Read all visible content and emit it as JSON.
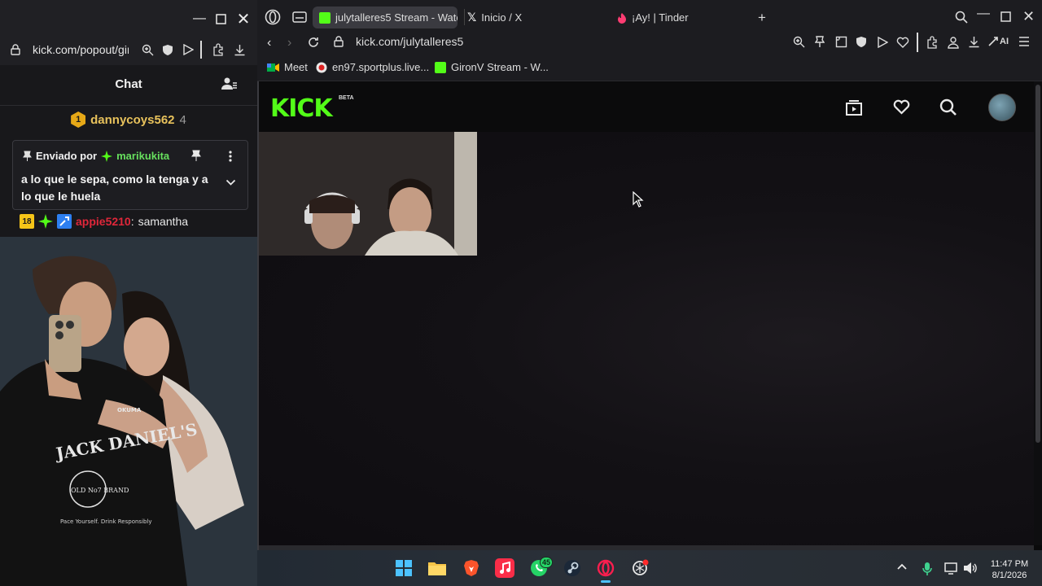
{
  "popout": {
    "url": "kick.com/popout/gir",
    "chat_title": "Chat",
    "leaderboard": {
      "rank": "1",
      "user": "dannycoys562",
      "count": "4"
    },
    "pinned": {
      "label": "Enviado por",
      "user": "marikukita",
      "message": "a lo que le sepa, como la tenga y a lo que le huela"
    },
    "chat_line": {
      "age_badge": "18",
      "user": "appie5210",
      "separator": ":",
      "message": "samantha"
    },
    "photo_text": {
      "brand": "JACK DANIEL'S",
      "no7": "OLD No7 BRAND",
      "slogan": "Pace Yourself. Drink Responsibly",
      "sponsor": "OKUMA"
    }
  },
  "browser": {
    "tabs": [
      {
        "label": "julytalleres5 Stream - Watc",
        "active": true
      },
      {
        "label": "Inicio / X",
        "active": false
      },
      {
        "label": "¡Ay! | Tinder",
        "active": false
      }
    ],
    "url": "kick.com/julytalleres5",
    "ai_label": "AI",
    "bookmarks": [
      {
        "label": "Meet"
      },
      {
        "label": "en97.sportplus.live..."
      },
      {
        "label": "GironV Stream - W..."
      }
    ]
  },
  "kick": {
    "logo": "KICK",
    "beta": "BETA"
  },
  "taskbar": {
    "whatsapp_badge": "45",
    "time": "11:47 PM",
    "date": "8/1/2026"
  },
  "colors": {
    "kick_green": "#53fc18",
    "leader_gold": "#e8c25c",
    "pinned_user_green": "#67e05e",
    "chat_user_red": "#e0273a"
  }
}
